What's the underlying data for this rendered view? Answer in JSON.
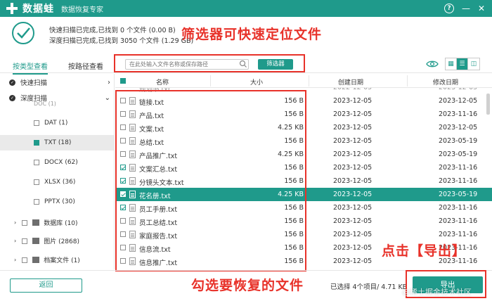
{
  "titlebar": {
    "app_name": "数据蛙",
    "app_subtitle": "数据恢复专家",
    "help_label": "?",
    "minimize_label": "—",
    "close_label": "✕"
  },
  "status": {
    "quick_scan": "快速扫描已完成,已找到 0 个文件 (0.00  B)",
    "deep_scan": "深度扫描已完成,已找到 3050 个文件 (1.29 GB)"
  },
  "annotations": {
    "filter_hint": "筛选器可快速定位文件",
    "select_hint": "勾选要恢复的文件",
    "export_hint": "点击【导出】"
  },
  "tabs": [
    {
      "label": "按类型查看",
      "active": true
    },
    {
      "label": "按路径查看",
      "active": false
    }
  ],
  "search": {
    "placeholder": "在此处输入文件名称或保存路径",
    "filter_button": "筛选器"
  },
  "view_buttons": [
    "grid",
    "list",
    "detail"
  ],
  "sidebar": {
    "scan_modes": [
      {
        "label": "快速扫描"
      },
      {
        "label": "深度扫描"
      }
    ],
    "partial_top": "DOC (1)",
    "types": [
      {
        "label": "DAT (1)",
        "state": "unchecked"
      },
      {
        "label": "TXT (18)",
        "state": "filled"
      },
      {
        "label": "DOCX (62)",
        "state": "unchecked"
      },
      {
        "label": "XLSX (36)",
        "state": "unchecked"
      },
      {
        "label": "PPTX (30)",
        "state": "unchecked"
      }
    ],
    "categories": [
      {
        "label": "数据库 (10)",
        "icon": "database-icon"
      },
      {
        "label": "图片 (2868)",
        "icon": "image-icon"
      },
      {
        "label": "档案文件 (1)",
        "icon": "archive-icon"
      }
    ]
  },
  "table": {
    "headers": {
      "name": "名称",
      "size": "大小",
      "created": "创建日期",
      "modified": "修改日期"
    },
    "partial_row": {
      "name": "规划书.txt",
      "created": "2022-12-05",
      "modified": "2023-12-05"
    },
    "rows": [
      {
        "name": "链接.txt",
        "size": "156  B",
        "created": "2023-12-05",
        "modified": "2023-12-05",
        "checked": false,
        "selected": false
      },
      {
        "name": "产品.txt",
        "size": "156  B",
        "created": "2023-12-05",
        "modified": "2023-11-16",
        "checked": false,
        "selected": false
      },
      {
        "name": "文案.txt",
        "size": "4.25 KB",
        "created": "2023-12-05",
        "modified": "2023-12-05",
        "checked": false,
        "selected": false
      },
      {
        "name": "总结.txt",
        "size": "156  B",
        "created": "2023-12-05",
        "modified": "2023-05-19",
        "checked": false,
        "selected": false
      },
      {
        "name": "产品推广.txt",
        "size": "4.25 KB",
        "created": "2023-12-05",
        "modified": "2023-05-19",
        "checked": false,
        "selected": false
      },
      {
        "name": "文案汇总.txt",
        "size": "156  B",
        "created": "2023-12-05",
        "modified": "2023-11-16",
        "checked": true,
        "selected": false
      },
      {
        "name": "分镜头文本.txt",
        "size": "156  B",
        "created": "2023-12-05",
        "modified": "2023-11-16",
        "checked": true,
        "selected": false
      },
      {
        "name": "花名册.txt",
        "size": "4.25 KB",
        "created": "2023-12-05",
        "modified": "2023-05-19",
        "checked": true,
        "selected": true
      },
      {
        "name": "员工手册.txt",
        "size": "156  B",
        "created": "2023-12-05",
        "modified": "2023-11-16",
        "checked": true,
        "selected": false
      },
      {
        "name": "员工总结.txt",
        "size": "156  B",
        "created": "2023-12-05",
        "modified": "2023-11-16",
        "checked": false,
        "selected": false
      },
      {
        "name": "家庭报告.txt",
        "size": "156  B",
        "created": "2023-12-05",
        "modified": "2023-11-16",
        "checked": false,
        "selected": false
      },
      {
        "name": "信息流.txt",
        "size": "156  B",
        "created": "2023-12-05",
        "modified": "2023-11-16",
        "checked": false,
        "selected": false
      },
      {
        "name": "信息推广.txt",
        "size": "156  B",
        "created": "2023-12-05",
        "modified": "2023-11-16",
        "checked": false,
        "selected": false
      }
    ]
  },
  "bottom": {
    "back_button": "返回",
    "selected_count": "已选择 4个项目/ 4.71 KB",
    "export_button": "导出",
    "watermark": "@稀土掘金技术社区"
  },
  "colors": {
    "accent": "#1f9a8b",
    "annotation": "#e8322a"
  }
}
